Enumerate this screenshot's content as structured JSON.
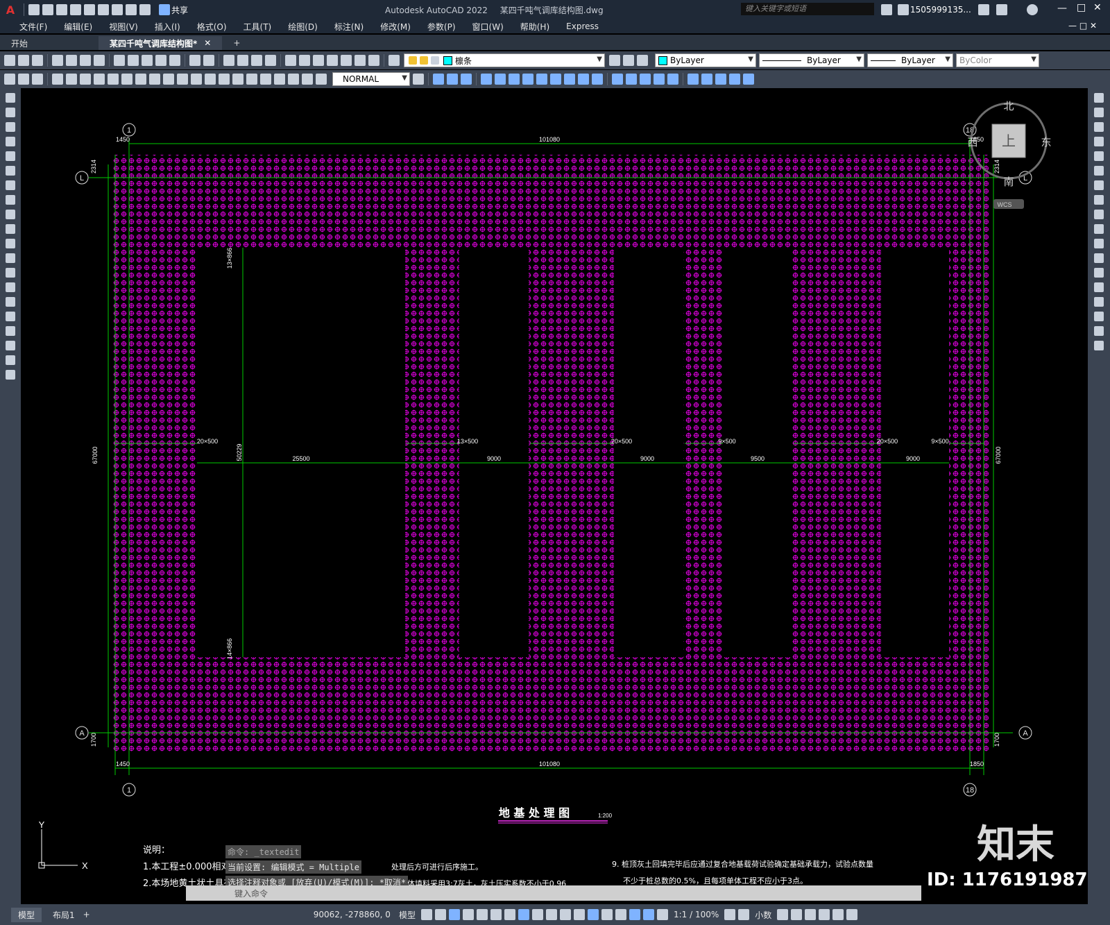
{
  "app": {
    "title": "Autodesk AutoCAD 2022",
    "file": "某四千吨气调库结构图.dwg",
    "share_label": "共享",
    "search_placeholder": "键入关键字或短语",
    "user": "1505999135...",
    "logo": "A"
  },
  "menu": [
    "文件(F)",
    "编辑(E)",
    "视图(V)",
    "插入(I)",
    "格式(O)",
    "工具(T)",
    "绘图(D)",
    "标注(N)",
    "修改(M)",
    "参数(P)",
    "窗口(W)",
    "帮助(H)",
    "Express"
  ],
  "tabs": {
    "start": "开始",
    "drawing": "某四千吨气调库结构图*"
  },
  "toolbar": {
    "layer": "檩条",
    "color": "ByLayer",
    "linetype": "ByLayer",
    "lineweight": "ByLayer",
    "plotstyle": "ByColor",
    "dimstyle": "NORMAL"
  },
  "viewcube": {
    "north": "北",
    "south": "南",
    "east": "东",
    "west": "西",
    "top": "上",
    "wcs": "WCS"
  },
  "drawing": {
    "grid_1": "1",
    "grid_18": "18",
    "grid_L": "L",
    "grid_A": "A",
    "dim_total": "101080",
    "dim_left_offset": "1450",
    "dim_right_offset": "1850",
    "dim_top_offset": "2314",
    "dim_bottom_offset": "1700",
    "dim_height": "67000",
    "dim_inner_height": "50229",
    "dim_top_piles": "13×866",
    "dim_bottom_piles": "14×866",
    "piles_a": "20×500",
    "piles_b": "13×500",
    "piles_c": "20×500",
    "piles_d": "9×500",
    "piles_e": "20×500",
    "piles_f": "9×500",
    "gap_1": "25500",
    "gap_2": "9000",
    "gap_3": "9000",
    "gap_4": "9500",
    "gap_5": "9000",
    "title": "地 基 处 理 图",
    "scale": "1:200",
    "notes_heading": "说明：",
    "note_1": "1.本工程±0.000相对应的绝对标高以现场确定的为准。",
    "note_2": "2.本场地黄土状土具有湿陷性。",
    "note_4": "处理后方可进行后序施工。",
    "note_5": "5. 桩体填料采用3:7灰土，灰土压实系数不小于0.96",
    "note_9a": "9. 桩顶灰土回填完毕后应通过复合地基载荷试验确定基础承载力，试验点数量",
    "note_9b": "不少于桩总数的0.5%，且每项单体工程不应小于3点。"
  },
  "ucs": {
    "y": "Y",
    "x": "X"
  },
  "command": {
    "line1": "命令: _textedit",
    "line2": "当前设置: 编辑模式 = Multiple",
    "line3": "选择注释对象或 [放弃(U)/模式(M)]: *取消*",
    "prompt": "键入命令"
  },
  "status": {
    "model_tab": "模型",
    "layout_tab": "布局1",
    "add_tab": "+",
    "coords": "90062, -278860, 0",
    "space": "模型",
    "scale": "1:1 / 100%",
    "units": "小数"
  },
  "watermark": {
    "brand": "知末",
    "id": "ID: 1176191987"
  },
  "colors": {
    "piles": "#d400d4",
    "dimension": "#00ff00",
    "chrome": "#3b4452",
    "title_bar": "#1f2937"
  }
}
